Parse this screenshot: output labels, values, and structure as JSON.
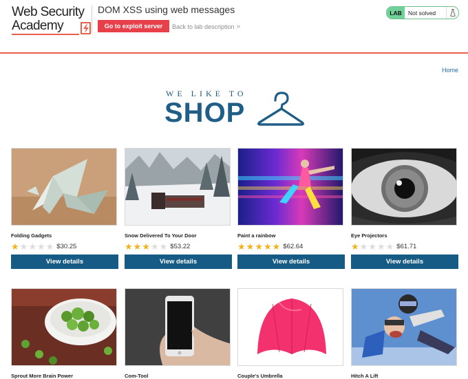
{
  "header": {
    "logo_line1": "Web Security",
    "logo_line2": "Academy",
    "lab_title": "DOM XSS using web messages",
    "exploit_button": "Go to exploit server",
    "back_link": "Back to lab description",
    "back_chevron": "»",
    "status_badge": "LAB",
    "status_text": "Not solved"
  },
  "nav": {
    "home": "Home"
  },
  "banner": {
    "tagline": "WE LIKE TO",
    "title": "SHOP"
  },
  "colors": {
    "accent": "#e8604c",
    "button_primary": "#155b85",
    "exploit_red": "#e8404b",
    "status_green": "#70d199",
    "star_on": "#f2b21a",
    "star_off": "#dcdcdc"
  },
  "products": [
    {
      "name": "Folding Gadgets",
      "rating": 1,
      "price": "$30.25",
      "button": "View details",
      "image": "origami-bird"
    },
    {
      "name": "Snow Delivered To Your Door",
      "rating": 3,
      "price": "$53.22",
      "button": "View details",
      "image": "snow-train"
    },
    {
      "name": "Paint a rainbow",
      "rating": 5,
      "price": "$62.64",
      "button": "View details",
      "image": "rainbow-runner"
    },
    {
      "name": "Eye Projectors",
      "rating": 1,
      "price": "$61.71",
      "button": "View details",
      "image": "eye"
    },
    {
      "name": "Sprout More Brain Power",
      "image": "sprouts"
    },
    {
      "name": "Com-Tool",
      "image": "phone-in-hand"
    },
    {
      "name": "Couple's Umbrella",
      "image": "pink-umbrella"
    },
    {
      "name": "Hitch A Lift",
      "image": "skydivers"
    }
  ]
}
